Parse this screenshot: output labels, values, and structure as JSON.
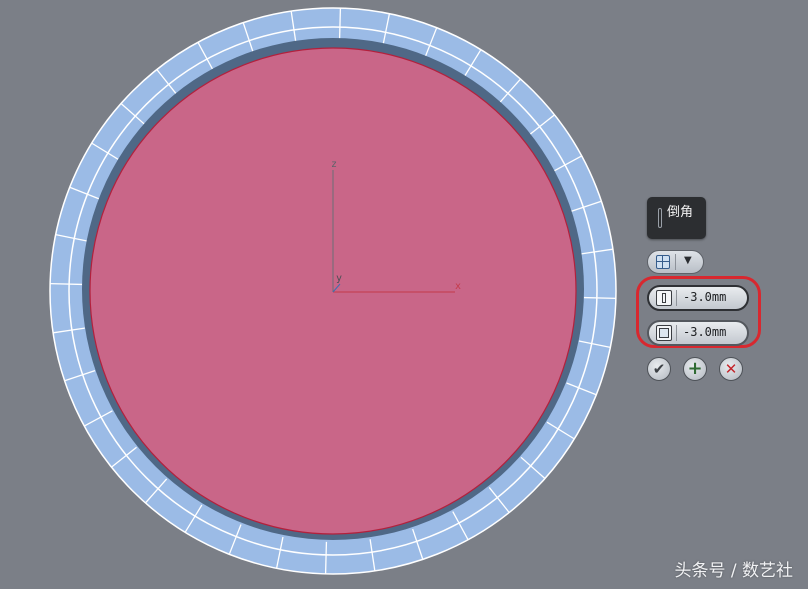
{
  "scene": {
    "axes": {
      "z_label": "z",
      "y_label": "y",
      "x_label": "x"
    },
    "colors": {
      "background": "#7b7f87",
      "outer_ring": "#9bbbe6",
      "inner_band": "#4f6886",
      "cap_face": "#c96688",
      "edge": "#ffffff",
      "selection_outline": "#b3203c",
      "x_axis": "#c43a4a",
      "z_axis": "#6b6f76"
    },
    "ring_segments": 36
  },
  "caddy": {
    "title": "倒角",
    "type_dropdown_icon": "grid-icon",
    "height_value": "-3.0mm",
    "outline_value": "-3.0mm",
    "ok_symbol": "✔",
    "apply_symbol": "+",
    "cancel_symbol": "✕"
  },
  "watermark": "头条号 / 数艺社"
}
